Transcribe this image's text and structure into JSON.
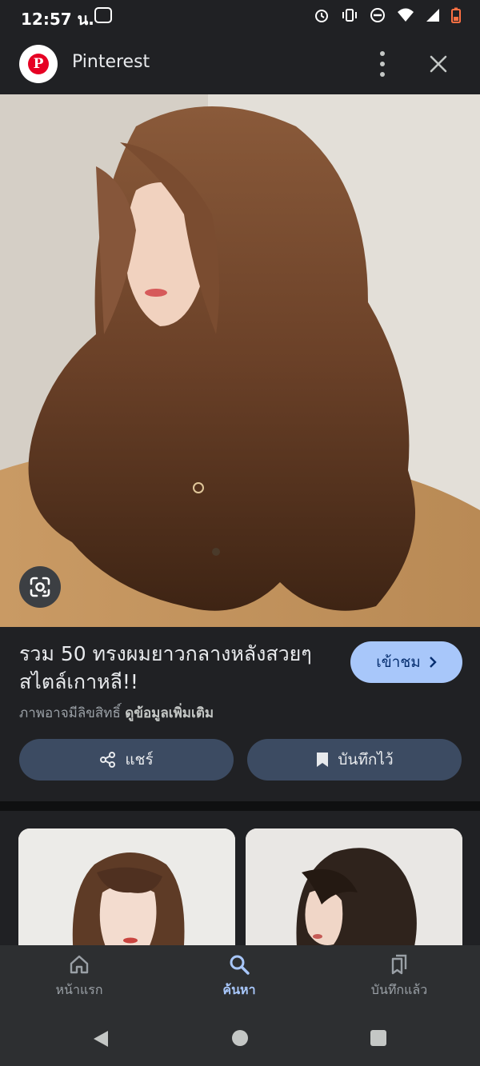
{
  "status_bar": {
    "time": "12:57 น."
  },
  "header": {
    "site_name": "Pinterest",
    "logo_letter": "P"
  },
  "result": {
    "title": "รวม 50 ทรงผมยาวกลางหลังสวยๆ สไตล์เกาหลี!!",
    "visit_label": "เข้าชม",
    "copyright_text": "ภาพอาจมีลิขสิทธิ์",
    "more_info_link": "ดูข้อมูลเพิ่มเติม",
    "share_label": "แชร์",
    "save_label": "บันทึกไว้"
  },
  "bottom_nav": {
    "items": [
      {
        "label": "หน้าแรก",
        "icon": "home-icon"
      },
      {
        "label": "ค้นหา",
        "icon": "search-icon",
        "active": true
      },
      {
        "label": "บันทึกแล้ว",
        "icon": "saved-icon"
      }
    ]
  },
  "colors": {
    "background": "#202124",
    "accent": "#a8c7fa",
    "pill": "#3c4b62",
    "pinterest_red": "#e60023"
  }
}
